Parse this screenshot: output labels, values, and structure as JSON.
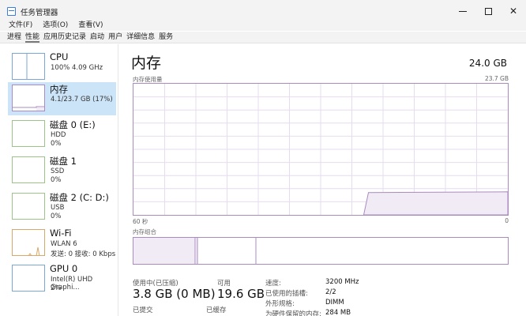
{
  "window": {
    "title": "任务管理器"
  },
  "menu": [
    "文件(F)",
    "选项(O)",
    "查看(V)"
  ],
  "tabs": [
    {
      "label": "进程",
      "active": false
    },
    {
      "label": "性能",
      "active": true
    },
    {
      "label": "应用历史记录",
      "active": false
    },
    {
      "label": "启动",
      "active": false
    },
    {
      "label": "用户",
      "active": false
    },
    {
      "label": "详细信息",
      "active": false
    },
    {
      "label": "服务",
      "active": false
    }
  ],
  "sidebar": {
    "items": [
      {
        "title": "CPU",
        "lines": [
          "100% 4.09 GHz"
        ],
        "icon": "cpu-graph",
        "selected": false
      },
      {
        "title": "内存",
        "lines": [
          "4.1/23.7 GB (17%)"
        ],
        "icon": "memory-graph",
        "selected": true
      },
      {
        "title": "磁盘 0 (E:)",
        "lines": [
          "HDD",
          "0%"
        ],
        "icon": "disk-graph",
        "selected": false
      },
      {
        "title": "磁盘 1",
        "lines": [
          "SSD",
          "0%"
        ],
        "icon": "disk-graph",
        "selected": false
      },
      {
        "title": "磁盘 2 (C: D:)",
        "lines": [
          "USB",
          "0%"
        ],
        "icon": "disk-graph",
        "selected": false
      },
      {
        "title": "Wi-Fi",
        "lines": [
          "WLAN 6",
          "发送: 0 接收: 0 Kbps"
        ],
        "icon": "network-graph",
        "selected": false
      },
      {
        "title": "GPU 0",
        "lines": [
          "Intel(R) UHD Graphi...",
          "2%"
        ],
        "icon": "gpu-graph",
        "selected": false
      }
    ]
  },
  "main": {
    "title": "内存",
    "total": "24.0 GB",
    "usage_label": "内存使用量",
    "usage_max": "23.7 GB",
    "axis_left": "60 秒",
    "axis_right": "0",
    "composition_label": "内存组合",
    "memory_usage_fraction": 0.17,
    "stats": {
      "in_use_label": "使用中(已压缩)",
      "in_use_value": "3.8 GB (0 MB)",
      "available_label": "可用",
      "available_value": "19.6 GB",
      "committed_label": "已提交",
      "cached_label": "已缓存"
    },
    "details": [
      {
        "label": "速度:",
        "value": "3200 MHz"
      },
      {
        "label": "已使用的插槽:",
        "value": "2/2"
      },
      {
        "label": "外形规格:",
        "value": "DIMM"
      },
      {
        "label": "为硬件保留的内存:",
        "value": "284 MB"
      }
    ]
  },
  "colors": {
    "accent": "#8b4fa3",
    "graph_border": "#a98bc0",
    "graph_fill": "#f1ebf5",
    "selection": "#cce4f7",
    "thumb_border": "#7aa7d9"
  }
}
